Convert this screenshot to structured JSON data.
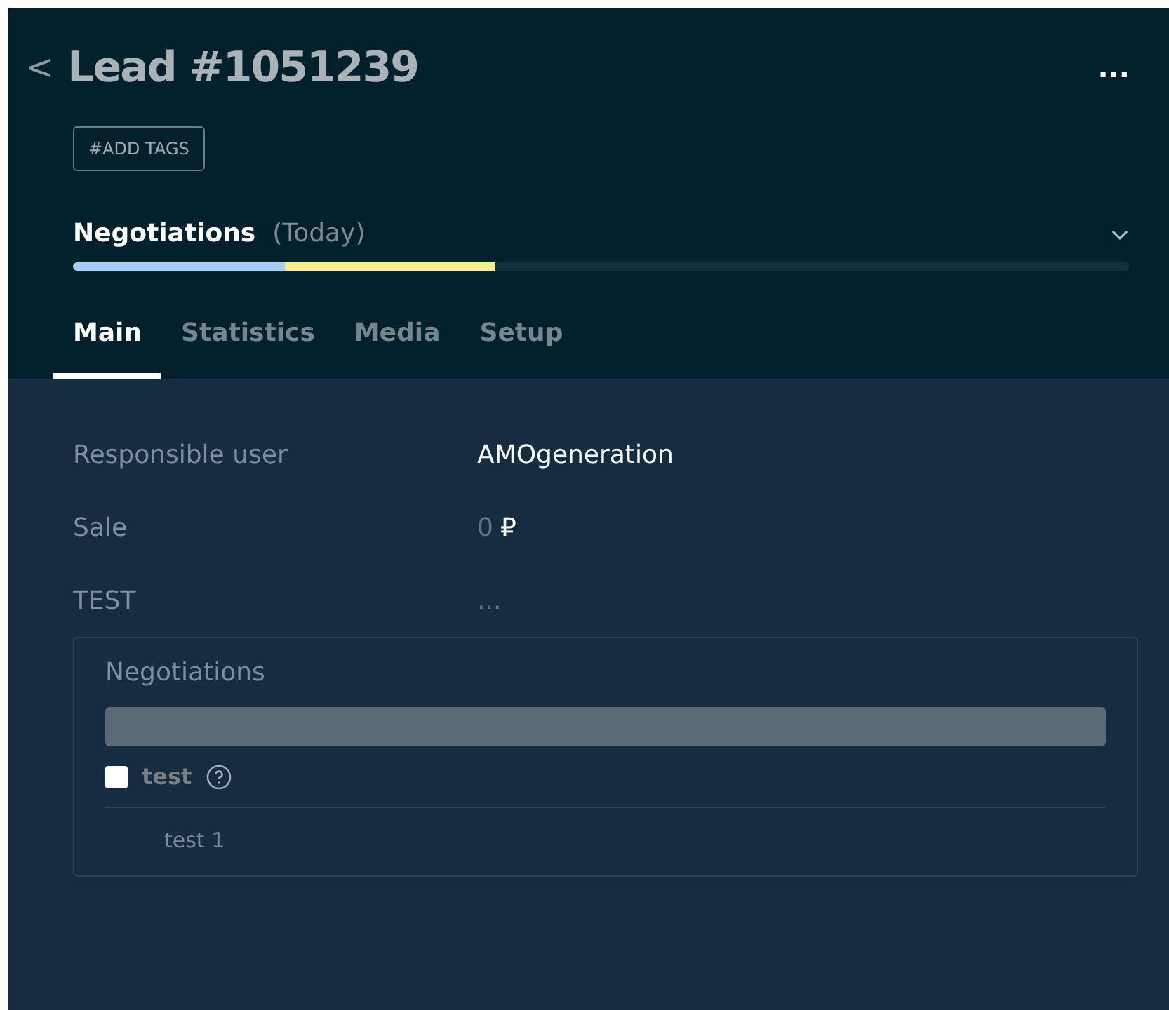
{
  "header": {
    "back": "<",
    "title": "Lead #1051239",
    "more": "..."
  },
  "tags_button": "#ADD TAGS",
  "pipeline": {
    "stage": "Negotiations",
    "when": "(Today)",
    "expanded": false,
    "segments": [
      {
        "color": "#a3cdf7",
        "level": 0.2
      },
      {
        "color": "#f5ee8a",
        "level": 0.2
      }
    ]
  },
  "tabs": [
    {
      "label": "Main",
      "selected": true
    },
    {
      "label": "Statistics",
      "selected": false
    },
    {
      "label": "Media",
      "selected": false
    },
    {
      "label": "Setup",
      "selected": false
    }
  ],
  "fields": [
    {
      "label": "Responsible user",
      "value": "AMOgeneration",
      "kind": "text"
    },
    {
      "label": "Sale",
      "value": "0",
      "currency": "₽",
      "kind": "money"
    },
    {
      "label": "TEST",
      "value": "...",
      "kind": "empty"
    }
  ],
  "group": {
    "title": "Negotiations",
    "checkbox": {
      "label": "test",
      "checked": false
    },
    "item": "test 1"
  }
}
